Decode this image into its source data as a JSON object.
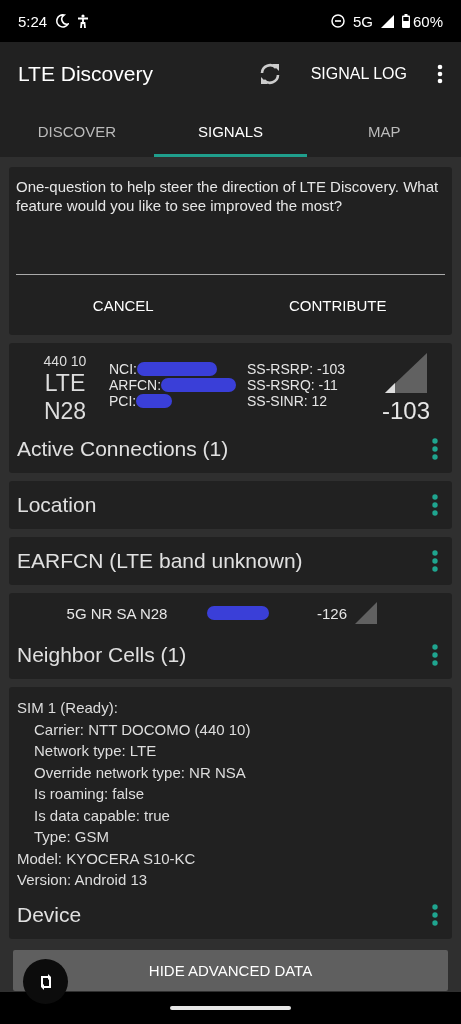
{
  "status_bar": {
    "time": "5:24",
    "network": "5G",
    "battery": "60%"
  },
  "app_bar": {
    "title": "LTE Discovery",
    "action": "SIGNAL LOG"
  },
  "tabs": [
    {
      "label": "DISCOVER",
      "selected": false
    },
    {
      "label": "SIGNALS",
      "selected": true
    },
    {
      "label": "MAP",
      "selected": false
    }
  ],
  "survey": {
    "message": "One-question to help steer the direction of LTE Discovery. What feature would you like to see improved the most?",
    "buttons": [
      "CANCEL",
      "CONTRIBUTE"
    ]
  },
  "active_cell": {
    "plmn": "440 10",
    "tech": "LTE",
    "band": "N28",
    "fields": [
      "NCI:",
      "ARFCN:",
      "PCI:"
    ],
    "metrics": [
      "SS-RSRP: -103",
      "SS-RSRQ: -11",
      "SS-SINR: 12"
    ],
    "reading": "-103",
    "title": "Active Connections (1)"
  },
  "sections": [
    {
      "title": "Location"
    },
    {
      "title": "EARFCN (LTE band unknown)"
    }
  ],
  "neighbor": {
    "cells": [
      {
        "name": "5G NR SA N28",
        "reading": "-126"
      }
    ],
    "title": "Neighbor Cells (1)"
  },
  "device": {
    "lines": [
      {
        "text": "SIM 1 (Ready):",
        "children": [
          {
            "text": "Carrier: NTT DOCOMO (440 10)"
          },
          {
            "text": "Network type: LTE"
          },
          {
            "text": "Override network type: NR NSA"
          },
          {
            "text": "Is roaming: false"
          },
          {
            "text": "Is data capable: true"
          },
          {
            "text": "Type: GSM"
          }
        ]
      },
      {
        "text": "Model: KYOCERA S10-KC"
      },
      {
        "text": "Version: Android 13"
      }
    ],
    "title": "Device"
  },
  "bottom_button": "HIDE ADVANCED DATA"
}
